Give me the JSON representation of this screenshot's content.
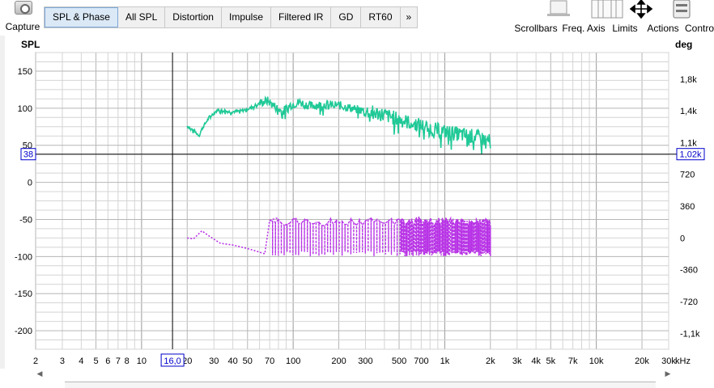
{
  "toolbar": {
    "capture_label": "Capture",
    "tabs": [
      "SPL & Phase",
      "All SPL",
      "Distortion",
      "Impulse",
      "Filtered IR",
      "GD",
      "RT60",
      "»"
    ],
    "active_tab": 0,
    "tools": [
      {
        "label": "Scrollbars",
        "icon": "scrollbars-icon"
      },
      {
        "label": "Freq. Axis",
        "icon": "freq-axis-icon"
      },
      {
        "label": "Limits",
        "icon": "limits-icon"
      },
      {
        "label": "Actions",
        "icon": "actions-icon"
      },
      {
        "label": "Controls",
        "icon": "gear-icon"
      }
    ]
  },
  "graph": {
    "left_axis_title": "SPL",
    "right_axis_title": "deg",
    "freq_unit": "kHz",
    "cursor": {
      "spl_readout": "38",
      "freq_readout": "16,0",
      "phase_readout": "1,02k",
      "spl": 38,
      "freq": 16
    },
    "colors": {
      "spl": "#20c997",
      "phase": "#b833e6",
      "cursor": "#000000",
      "readout": "#0000cc",
      "grid_major": "#9a9a9a",
      "grid_minor": "#d4d4d4"
    }
  },
  "chart_data": {
    "type": "line",
    "xscale": "log",
    "xlim": [
      2,
      30000
    ],
    "ylim_left": [
      -225,
      175
    ],
    "ylim_right": [
      -1260,
      2100
    ],
    "left_ticks": [
      150,
      100,
      50,
      0,
      -50,
      -100,
      -150,
      -200
    ],
    "right_ticks": [
      "1,8k",
      "1,4k",
      "1,1k",
      "720",
      "360",
      "0",
      "-360",
      "-720",
      "-1,1k"
    ],
    "right_tick_values": [
      1800,
      1440,
      1080,
      720,
      360,
      0,
      -360,
      -720,
      -1080
    ],
    "x_tick_labels": [
      {
        "v": 2,
        "t": "2"
      },
      {
        "v": 3,
        "t": "3"
      },
      {
        "v": 4,
        "t": "4"
      },
      {
        "v": 5,
        "t": "5"
      },
      {
        "v": 6,
        "t": "6"
      },
      {
        "v": 7,
        "t": "7"
      },
      {
        "v": 8,
        "t": "8"
      },
      {
        "v": 10,
        "t": "10"
      },
      {
        "v": 20,
        "t": "20"
      },
      {
        "v": 30,
        "t": "30"
      },
      {
        "v": 40,
        "t": "40"
      },
      {
        "v": 50,
        "t": "50"
      },
      {
        "v": 70,
        "t": "70"
      },
      {
        "v": 100,
        "t": "100"
      },
      {
        "v": 200,
        "t": "200"
      },
      {
        "v": 300,
        "t": "300"
      },
      {
        "v": 500,
        "t": "500"
      },
      {
        "v": 700,
        "t": "700"
      },
      {
        "v": 1000,
        "t": "1k"
      },
      {
        "v": 2000,
        "t": "2k"
      },
      {
        "v": 3000,
        "t": "3k"
      },
      {
        "v": 4000,
        "t": "4k"
      },
      {
        "v": 5000,
        "t": "5k"
      },
      {
        "v": 7000,
        "t": "7k"
      },
      {
        "v": 10000,
        "t": "10k"
      },
      {
        "v": 20000,
        "t": "20k"
      },
      {
        "v": 30000,
        "t": "30k"
      }
    ],
    "series": [
      {
        "axis": "left",
        "style": "solid",
        "freq_range": [
          20,
          2000
        ],
        "points": [
          [
            20,
            76
          ],
          [
            22,
            70
          ],
          [
            24,
            63
          ],
          [
            25,
            72
          ],
          [
            28,
            88
          ],
          [
            32,
            98
          ],
          [
            38,
            95
          ],
          [
            45,
            96
          ],
          [
            52,
            100
          ],
          [
            60,
            107
          ],
          [
            68,
            110
          ],
          [
            75,
            103
          ],
          [
            85,
            95
          ],
          [
            95,
            104
          ],
          [
            110,
            108
          ],
          [
            130,
            103
          ],
          [
            160,
            105
          ],
          [
            200,
            104
          ],
          [
            240,
            100
          ],
          [
            300,
            96
          ],
          [
            380,
            92
          ],
          [
            480,
            86
          ],
          [
            600,
            80
          ],
          [
            750,
            75
          ],
          [
            900,
            70
          ],
          [
            1100,
            67
          ],
          [
            1300,
            64
          ],
          [
            1600,
            62
          ],
          [
            2000,
            55
          ]
        ]
      },
      {
        "axis": "right",
        "style": "dotted",
        "freq_range": [
          20,
          2000
        ],
        "points": [
          [
            20,
            0
          ],
          [
            22,
            -10
          ],
          [
            25,
            80
          ],
          [
            28,
            20
          ],
          [
            33,
            -60
          ],
          [
            40,
            -80
          ],
          [
            50,
            -120
          ],
          [
            60,
            -160
          ],
          [
            65,
            -180
          ],
          [
            70,
            200
          ],
          [
            80,
            230
          ]
        ]
      }
    ]
  }
}
